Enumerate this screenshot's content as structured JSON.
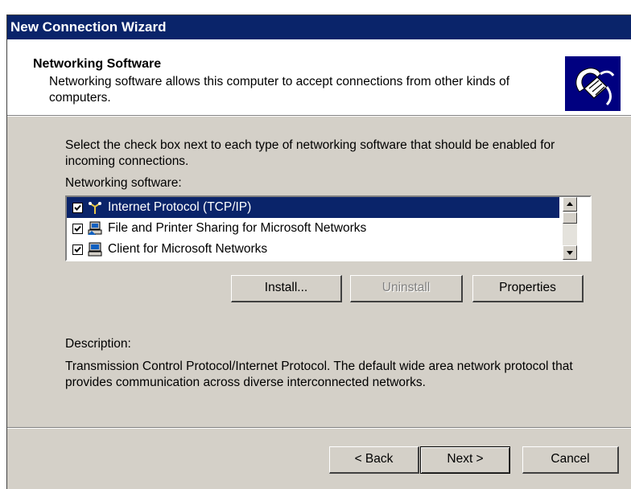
{
  "window": {
    "title": "New Connection Wizard"
  },
  "header": {
    "title": "Networking Software",
    "description": "Networking software allows this computer to accept connections from other kinds of computers.",
    "icon": "network-wizard-icon"
  },
  "main": {
    "intro": "Select the check box next to each type of networking software that should be enabled for incoming connections.",
    "list_label": "Networking software:",
    "items": [
      {
        "label": "Internet Protocol (TCP/IP)",
        "checked": true,
        "selected": true,
        "icon": "protocol-icon"
      },
      {
        "label": "File and Printer Sharing for Microsoft Networks",
        "checked": true,
        "selected": false,
        "icon": "sharing-icon"
      },
      {
        "label": "Client for Microsoft Networks",
        "checked": true,
        "selected": false,
        "icon": "client-icon"
      }
    ],
    "buttons": {
      "install": "Install...",
      "uninstall": "Uninstall",
      "properties": "Properties"
    },
    "description_label": "Description:",
    "description_text": "Transmission Control Protocol/Internet Protocol. The default wide area network protocol that provides communication across diverse interconnected networks."
  },
  "footer": {
    "back": "< Back",
    "next": "Next >",
    "cancel": "Cancel"
  },
  "colors": {
    "titlebar": "#0a246a",
    "selection": "#0a246a",
    "face": "#d4d0c8"
  }
}
